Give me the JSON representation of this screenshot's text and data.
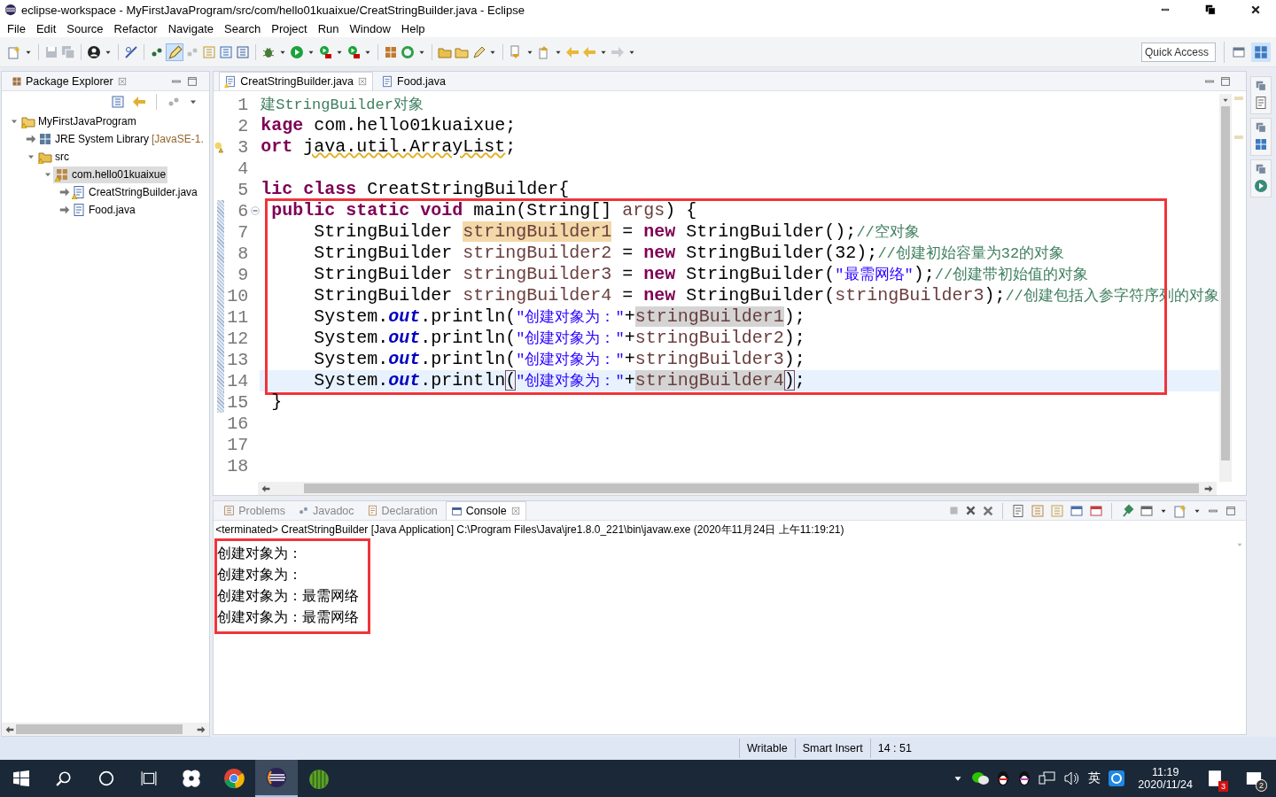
{
  "window": {
    "title": "eclipse-workspace - MyFirstJavaProgram/src/com/hello01kuaixue/CreatStringBuilder.java - Eclipse"
  },
  "menu": [
    "File",
    "Edit",
    "Source",
    "Refactor",
    "Navigate",
    "Search",
    "Project",
    "Run",
    "Window",
    "Help"
  ],
  "toolbar": {
    "mark_occurrences": true
  },
  "quick_access": {
    "placeholder": "Quick Access"
  },
  "package_explorer": {
    "title": "Package Explorer",
    "tree": [
      {
        "label": "MyFirstJavaProgram",
        "kind": "project",
        "warning": true,
        "expanded": true,
        "selected": false,
        "children": [
          {
            "label": "JRE System Library",
            "decoration": "[JavaSE-1.",
            "kind": "library",
            "warning": false,
            "expanded": false,
            "selected": false
          },
          {
            "label": "src",
            "kind": "folder",
            "warning": true,
            "expanded": true,
            "selected": false,
            "children": [
              {
                "label": "com.hello01kuaixue",
                "kind": "package",
                "warning": true,
                "expanded": true,
                "selected": true,
                "children": [
                  {
                    "label": "CreatStringBuilder.java",
                    "kind": "java",
                    "warning": true,
                    "expanded": false,
                    "selected": false
                  },
                  {
                    "label": "Food.java",
                    "kind": "java",
                    "warning": false,
                    "expanded": false,
                    "selected": false
                  }
                ]
              }
            ]
          }
        ]
      }
    ]
  },
  "editor": {
    "tabs": [
      {
        "label": "CreatStringBuilder.java",
        "selected": true,
        "warning": true
      },
      {
        "label": "Food.java",
        "selected": false,
        "warning": false
      }
    ],
    "blocks": [
      {
        "framed": false,
        "range": false,
        "lines": [
          {
            "number": "1",
            "current": false,
            "warning": false,
            "foldable": false,
            "tokens": [
              {
                "kind": "comment",
                "text": "建StringBuilder对象"
              }
            ]
          },
          {
            "number": "2",
            "current": false,
            "warning": false,
            "foldable": false,
            "tokens": [
              {
                "kind": "keyword",
                "text": "kage"
              },
              {
                "kind": "plain",
                "text": " com.hello01kuaixue;"
              }
            ]
          },
          {
            "number": "3",
            "current": false,
            "warning": true,
            "foldable": false,
            "tokens": [
              {
                "kind": "keyword",
                "text": "ort "
              },
              {
                "kind": "warning",
                "text": "java.util.ArrayList"
              },
              {
                "kind": "plain",
                "text": ";"
              }
            ]
          },
          {
            "number": "4",
            "current": false,
            "warning": false,
            "foldable": false
          },
          {
            "number": "5",
            "current": false,
            "warning": false,
            "foldable": false,
            "tokens": [
              {
                "kind": "keyword",
                "text": "lic class"
              },
              {
                "kind": "plain",
                "text": " CreatStringBuilder{"
              }
            ]
          }
        ]
      },
      {
        "framed": true,
        "range": true,
        "lines": [
          {
            "number": "6",
            "current": false,
            "warning": false,
            "foldable": true,
            "tokens": [
              {
                "kind": "keyword",
                "text": " public static void"
              },
              {
                "kind": "plain",
                "text": " main(String[] "
              },
              {
                "kind": "variable",
                "text": "args"
              },
              {
                "kind": "plain",
                "text": ") {"
              }
            ]
          },
          {
            "number": "7",
            "current": false,
            "warning": false,
            "foldable": false,
            "tokens": [
              {
                "kind": "plain",
                "text": "     StringBuilder "
              },
              {
                "kind": "write",
                "text": "stringBuilder1"
              },
              {
                "kind": "plain",
                "text": " = "
              },
              {
                "kind": "keyword",
                "text": "new"
              },
              {
                "kind": "plain",
                "text": " StringBuilder();"
              },
              {
                "kind": "comment",
                "text": "//空对象"
              }
            ]
          },
          {
            "number": "8",
            "current": false,
            "warning": false,
            "foldable": false,
            "tokens": [
              {
                "kind": "plain",
                "text": "     StringBuilder "
              },
              {
                "kind": "variable",
                "text": "stringBuilder2"
              },
              {
                "kind": "plain",
                "text": " = "
              },
              {
                "kind": "keyword",
                "text": "new"
              },
              {
                "kind": "plain",
                "text": " StringBuilder(32);"
              },
              {
                "kind": "comment",
                "text": "//创建初始容量为32的对象"
              }
            ]
          },
          {
            "number": "9",
            "current": false,
            "warning": false,
            "foldable": false,
            "tokens": [
              {
                "kind": "plain",
                "text": "     StringBuilder "
              },
              {
                "kind": "variable",
                "text": "stringBuilder3"
              },
              {
                "kind": "plain",
                "text": " = "
              },
              {
                "kind": "keyword",
                "text": "new"
              },
              {
                "kind": "plain",
                "text": " StringBuilder("
              },
              {
                "kind": "string",
                "text": "\"最需网络\""
              },
              {
                "kind": "plain",
                "text": ");"
              },
              {
                "kind": "comment",
                "text": "//创建带初始值的对象"
              }
            ]
          },
          {
            "number": "10",
            "current": false,
            "warning": false,
            "foldable": false,
            "tokens": [
              {
                "kind": "plain",
                "text": "     StringBuilder "
              },
              {
                "kind": "variable",
                "text": "stringBuilder4"
              },
              {
                "kind": "plain",
                "text": " = "
              },
              {
                "kind": "keyword",
                "text": "new"
              },
              {
                "kind": "plain",
                "text": " StringBuilder("
              },
              {
                "kind": "variable",
                "text": "stringBuilder3"
              },
              {
                "kind": "plain",
                "text": ");"
              },
              {
                "kind": "comment",
                "text": "//创建包括入参字符序列的对象"
              }
            ]
          },
          {
            "number": "11",
            "current": false,
            "warning": false,
            "foldable": false,
            "tokens": [
              {
                "kind": "plain",
                "text": "     System."
              },
              {
                "kind": "field",
                "text": "out"
              },
              {
                "kind": "plain",
                "text": ".println("
              },
              {
                "kind": "string",
                "text": "\"创建对象为：\""
              },
              {
                "kind": "plain",
                "text": "+"
              },
              {
                "kind": "read",
                "text": "stringBuilder1"
              },
              {
                "kind": "plain",
                "text": ");"
              }
            ]
          },
          {
            "number": "12",
            "current": false,
            "warning": false,
            "foldable": false,
            "tokens": [
              {
                "kind": "plain",
                "text": "     System."
              },
              {
                "kind": "field",
                "text": "out"
              },
              {
                "kind": "plain",
                "text": ".println("
              },
              {
                "kind": "string",
                "text": "\"创建对象为：\""
              },
              {
                "kind": "plain",
                "text": "+"
              },
              {
                "kind": "variable",
                "text": "stringBuilder2"
              },
              {
                "kind": "plain",
                "text": ");"
              }
            ]
          },
          {
            "number": "13",
            "current": false,
            "warning": false,
            "foldable": false,
            "tokens": [
              {
                "kind": "plain",
                "text": "     System."
              },
              {
                "kind": "field",
                "text": "out"
              },
              {
                "kind": "plain",
                "text": ".println("
              },
              {
                "kind": "string",
                "text": "\"创建对象为：\""
              },
              {
                "kind": "plain",
                "text": "+"
              },
              {
                "kind": "variable",
                "text": "stringBuilder3"
              },
              {
                "kind": "plain",
                "text": ");"
              }
            ]
          },
          {
            "number": "14",
            "current": true,
            "warning": false,
            "foldable": false,
            "tokens": [
              {
                "kind": "plain",
                "text": "     System."
              },
              {
                "kind": "field",
                "text": "out"
              },
              {
                "kind": "plain",
                "text": ".println"
              },
              {
                "kind": "bracket",
                "text": "("
              },
              {
                "kind": "string",
                "text": "\"创建对象为：\""
              },
              {
                "kind": "plain",
                "text": "+"
              },
              {
                "kind": "read",
                "text": "stringBuilder4"
              },
              {
                "kind": "bracket",
                "text": ")"
              },
              {
                "kind": "plain",
                "text": ";"
              }
            ]
          }
        ]
      },
      {
        "framed": false,
        "range": true,
        "lines": [
          {
            "number": "15",
            "current": false,
            "warning": false,
            "foldable": false,
            "tokens": [
              {
                "kind": "plain",
                "text": " }"
              }
            ]
          }
        ]
      },
      {
        "framed": false,
        "range": false,
        "lines": [
          {
            "number": "16",
            "current": false,
            "warning": false,
            "foldable": false
          },
          {
            "number": "17",
            "current": false,
            "warning": false,
            "foldable": false
          },
          {
            "number": "18",
            "current": false,
            "warning": false,
            "foldable": false
          }
        ]
      }
    ]
  },
  "console_panel": {
    "tabs": [
      {
        "label": "Problems",
        "kind": "problems",
        "selected": false
      },
      {
        "label": "Javadoc",
        "kind": "javadoc",
        "selected": false
      },
      {
        "label": "Declaration",
        "kind": "declaration",
        "selected": false
      },
      {
        "label": "Console",
        "kind": "console",
        "selected": true
      }
    ],
    "process": "<terminated> CreatStringBuilder [Java Application] C:\\Program Files\\Java\\jre1.8.0_221\\bin\\javaw.exe (2020年11月24日 上午11:19:21)",
    "output_framed": true,
    "output": [
      "创建对象为：",
      "创建对象为：",
      "创建对象为：最需网络",
      "创建对象为：最需网络"
    ]
  },
  "status_bar": [
    "Writable",
    "Smart Insert",
    "14 : 51"
  ],
  "taskbar": {
    "apps": [
      {
        "kind": "chrome",
        "active": false
      },
      {
        "kind": "eclipse",
        "active": true
      },
      {
        "kind": "melon",
        "active": false
      }
    ],
    "language": "英",
    "time": "11:19",
    "date": "2020/11/24",
    "notification_badge": "3",
    "action_badge": "2"
  }
}
